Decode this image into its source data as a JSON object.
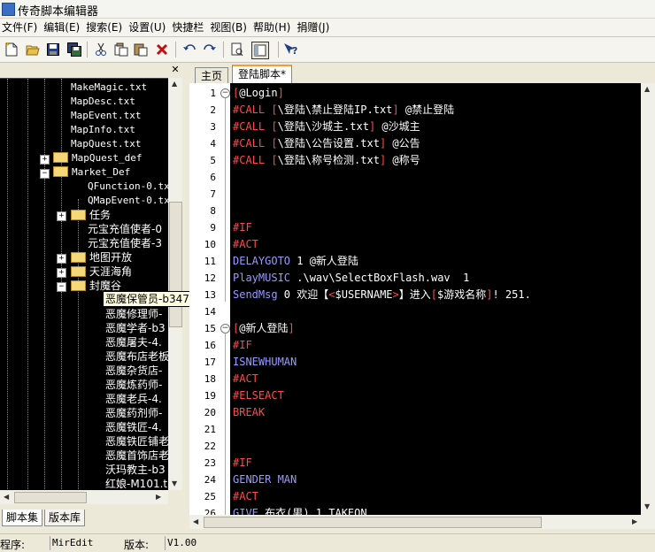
{
  "window": {
    "title": "传奇脚本编辑器"
  },
  "menu": [
    "文件(F)",
    "编辑(E)",
    "搜索(E)",
    "设置(U)",
    "快捷栏",
    "视图(B)",
    "帮助(H)",
    "捐赠(J)"
  ],
  "toolbar": {
    "icons": [
      "new-file-icon",
      "open-folder-icon",
      "save-icon",
      "save-all-icon",
      "cut-icon",
      "copy-icon",
      "paste-icon",
      "delete-icon",
      "undo-icon",
      "redo-icon",
      "find-doc-icon",
      "panel-toggle-icon",
      "help-icon"
    ]
  },
  "tree": {
    "items": [
      {
        "label": "MakeMagic.txt"
      },
      {
        "label": "MapDesc.txt"
      },
      {
        "label": "MapEvent.txt"
      },
      {
        "label": "MapInfo.txt"
      },
      {
        "label": "MapQuest.txt"
      },
      {
        "label": "MapQuest_def"
      },
      {
        "label": "Market_Def"
      },
      {
        "label": "QFunction-0.tx"
      },
      {
        "label": "QMapEvent-0.tx"
      },
      {
        "label": "任务"
      },
      {
        "label": "元宝充值使者-0"
      },
      {
        "label": "元宝充值使者-3"
      },
      {
        "label": "地图开放"
      },
      {
        "label": "天涯海角"
      },
      {
        "label": "封魔谷"
      },
      {
        "label": "恶魔修理师-"
      },
      {
        "label": "恶魔学者-b3"
      },
      {
        "label": "恶魔屠夫-4."
      },
      {
        "label": "恶魔布店老板"
      },
      {
        "label": "恶魔杂货店-"
      },
      {
        "label": "恶魔炼药师-"
      },
      {
        "label": "恶魔老兵-4."
      },
      {
        "label": "恶魔药剂师-"
      },
      {
        "label": "恶魔铁匠-4."
      },
      {
        "label": "恶魔铁匠铺老"
      },
      {
        "label": "恶魔首饰店老"
      },
      {
        "label": "沃玛教主-b3"
      },
      {
        "label": "红娘-M101.t"
      }
    ],
    "tooltip": "恶魔保管员-b347.txt"
  },
  "left_tabs": [
    "脚本集",
    "版本库"
  ],
  "editor_tabs": [
    "主页",
    "登陆脚本*"
  ],
  "colors": {
    "label": "#ff6a6a",
    "directive": "#ff4a4a",
    "command": "#9a9aff",
    "plain": "#ffffff",
    "comment": "#8a6a6a",
    "gutter": "#ffffff",
    "background": "#000000"
  },
  "code": [
    {
      "n": "1",
      "segs": [
        {
          "t": "[",
          "c": "#ff4a4a"
        },
        {
          "t": "@Login",
          "c": "#ffffff"
        },
        {
          "t": "]",
          "c": "#ff4a4a"
        }
      ]
    },
    {
      "n": "2",
      "segs": [
        {
          "t": "#CALL ",
          "c": "#ff4a4a"
        },
        {
          "t": "[",
          "c": "#ff4a4a"
        },
        {
          "t": "\\登陆\\禁止登陆IP.txt",
          "c": "#ffffff"
        },
        {
          "t": "] ",
          "c": "#ff4a4a"
        },
        {
          "t": "@禁止登陆",
          "c": "#ffffff"
        }
      ]
    },
    {
      "n": "3",
      "segs": [
        {
          "t": "#CALL ",
          "c": "#ff4a4a"
        },
        {
          "t": "[",
          "c": "#ff4a4a"
        },
        {
          "t": "\\登陆\\沙城主.txt",
          "c": "#ffffff"
        },
        {
          "t": "] ",
          "c": "#ff4a4a"
        },
        {
          "t": "@沙城主",
          "c": "#ffffff"
        }
      ]
    },
    {
      "n": "4",
      "segs": [
        {
          "t": "#CALL ",
          "c": "#ff4a4a"
        },
        {
          "t": "[",
          "c": "#ff4a4a"
        },
        {
          "t": "\\登陆\\公告设置.txt",
          "c": "#ffffff"
        },
        {
          "t": "] ",
          "c": "#ff4a4a"
        },
        {
          "t": "@公告",
          "c": "#ffffff"
        }
      ]
    },
    {
      "n": "5",
      "segs": [
        {
          "t": "#CALL ",
          "c": "#ff4a4a"
        },
        {
          "t": "[",
          "c": "#ff4a4a"
        },
        {
          "t": "\\登陆\\称号检测.txt",
          "c": "#ffffff"
        },
        {
          "t": "] ",
          "c": "#ff4a4a"
        },
        {
          "t": "@称号",
          "c": "#ffffff"
        }
      ]
    },
    {
      "n": "6",
      "segs": []
    },
    {
      "n": "7",
      "segs": []
    },
    {
      "n": "8",
      "segs": []
    },
    {
      "n": "9",
      "segs": [
        {
          "t": "#IF",
          "c": "#ff4a4a"
        }
      ]
    },
    {
      "n": "10",
      "segs": [
        {
          "t": "#ACT",
          "c": "#ff4a4a"
        }
      ]
    },
    {
      "n": "11",
      "segs": [
        {
          "t": "DELAYGOTO",
          "c": "#9a9aff"
        },
        {
          "t": " 1 @新人登陆",
          "c": "#ffffff"
        }
      ]
    },
    {
      "n": "12",
      "segs": [
        {
          "t": "PlayMUSIC",
          "c": "#9a9aff"
        },
        {
          "t": " .\\wav\\SelectBoxFlash.wav  1",
          "c": "#ffffff"
        }
      ]
    },
    {
      "n": "13",
      "segs": [
        {
          "t": "SendMsg",
          "c": "#9a9aff"
        },
        {
          "t": " 0 欢迎【",
          "c": "#ffffff"
        },
        {
          "t": "<",
          "c": "#ff4a4a"
        },
        {
          "t": "$USERNAME",
          "c": "#ffffff"
        },
        {
          "t": ">",
          "c": "#ff4a4a"
        },
        {
          "t": "】进入",
          "c": "#ffffff"
        },
        {
          "t": "[",
          "c": "#ff4a4a"
        },
        {
          "t": "$游戏名称",
          "c": "#ffffff"
        },
        {
          "t": "]",
          "c": "#ff4a4a"
        },
        {
          "t": "! 251.",
          "c": "#ffffff"
        }
      ]
    },
    {
      "n": "14",
      "segs": []
    },
    {
      "n": "15",
      "segs": [
        {
          "t": "[",
          "c": "#ff4a4a"
        },
        {
          "t": "@新人登陆",
          "c": "#ffffff"
        },
        {
          "t": "]",
          "c": "#ff4a4a"
        }
      ]
    },
    {
      "n": "16",
      "segs": [
        {
          "t": "#IF",
          "c": "#ff4a4a"
        }
      ]
    },
    {
      "n": "17",
      "segs": [
        {
          "t": "ISNEWHUMAN",
          "c": "#9a9aff"
        }
      ]
    },
    {
      "n": "18",
      "segs": [
        {
          "t": "#ACT",
          "c": "#ff4a4a"
        }
      ]
    },
    {
      "n": "19",
      "segs": [
        {
          "t": "#ELSEACT",
          "c": "#ff4a4a"
        }
      ]
    },
    {
      "n": "20",
      "segs": [
        {
          "t": "BREAK",
          "c": "#ff4a4a"
        }
      ]
    },
    {
      "n": "21",
      "segs": []
    },
    {
      "n": "22",
      "segs": []
    },
    {
      "n": "23",
      "segs": [
        {
          "t": "#IF",
          "c": "#ff4a4a"
        }
      ]
    },
    {
      "n": "24",
      "segs": [
        {
          "t": "GENDER MAN",
          "c": "#9a9aff"
        }
      ]
    },
    {
      "n": "25",
      "segs": [
        {
          "t": "#ACT",
          "c": "#ff4a4a"
        }
      ]
    },
    {
      "n": "26",
      "segs": [
        {
          "t": "GIVE",
          "c": "#9a9aff"
        },
        {
          "t": " 布衣(男) 1 TAKEON",
          "c": "#ffffff"
        }
      ]
    }
  ],
  "status": {
    "program_label": "程序:",
    "program_value": "MirEdit",
    "version_label": "版本:",
    "version_value": "V1.00"
  }
}
